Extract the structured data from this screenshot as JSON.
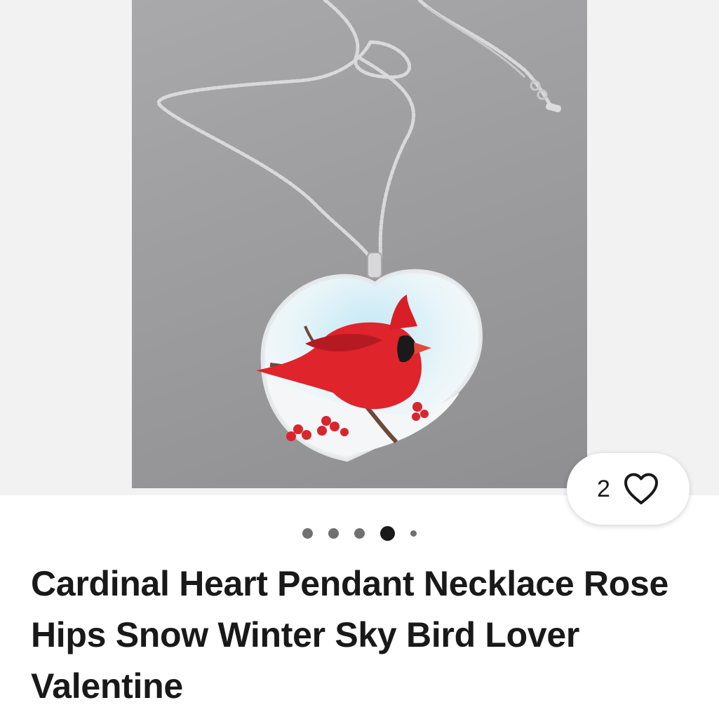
{
  "listing": {
    "title": "Cardinal Heart Pendant Necklace Rose Hips Snow Winter Sky Bird Lover Valentine",
    "favorites": {
      "count": "2",
      "icon": "heart-outline-icon"
    },
    "gallery": {
      "image_count": 5,
      "active_index": 3,
      "image_subject": "cardinal-heart-pendant-necklace"
    }
  },
  "colors": {
    "photo_background": "#9d9d9f",
    "active_dot": "#191919",
    "inactive_dot": "#707070",
    "title_text": "#191919"
  }
}
